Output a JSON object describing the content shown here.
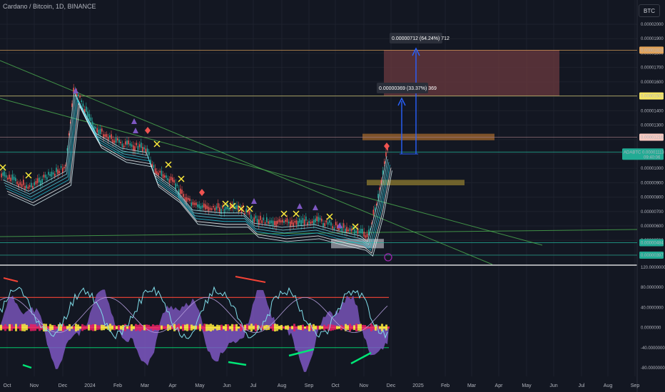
{
  "title": "Cardano / Bitcoin, 1D, BINANCE",
  "currency": "BTC",
  "chart_data": [
    {
      "type": "line",
      "name": "price",
      "x": [
        "Oct",
        "Nov",
        "Dec",
        "2024",
        "Feb",
        "Mar",
        "Apr",
        "May",
        "Jun",
        "Jul",
        "Aug",
        "Sep",
        "Oct",
        "Nov",
        "Dec",
        "2025",
        "Feb",
        "Mar",
        "Apr",
        "May",
        "Jun",
        "Jul",
        "Aug",
        "Sep"
      ],
      "price_path": [
        [
          "Oct",
          9.5e-06
        ],
        [
          "Nov",
          8.7e-06
        ],
        [
          "Nov",
          1.01e-05
        ],
        [
          "Dec",
          1.56e-05
        ],
        [
          "Dec",
          1.42e-05
        ],
        [
          "2024",
          1.27e-05
        ],
        [
          "Feb",
          1.17e-05
        ],
        [
          "Mar",
          1.14e-05
        ],
        [
          "Mar",
          1e-05
        ],
        [
          "Apr",
          8.9e-06
        ],
        [
          "May",
          7.4e-06
        ],
        [
          "Jun",
          7.2e-06
        ],
        [
          "Jul",
          7.2e-06
        ],
        [
          "Jul",
          6.5e-06
        ],
        [
          "Aug",
          6.2e-06
        ],
        [
          "Sep",
          6.4e-06
        ],
        [
          "Oct",
          6e-06
        ],
        [
          "Oct",
          5.6e-06
        ],
        [
          "Nov",
          5.2e-06
        ],
        [
          "Nov",
          8e-06
        ],
        [
          "Dec",
          1.113e-05
        ]
      ],
      "yaxis_ticks": [
        "0.00002000",
        "0.00001900",
        "0.00001800",
        "0.00001700",
        "0.00001600",
        "0.00001500",
        "0.00001400",
        "0.00001300",
        "0.00001200",
        "0.00001100",
        "0.00001000",
        "0.00000900",
        "0.00000800",
        "0.00000700",
        "0.00000600",
        "0.00000500",
        "0.00000400"
      ],
      "ylim": [
        3.7e-06,
        2.06e-05
      ],
      "price_labels": [
        {
          "value": 1.82e-05,
          "text": "0.00001820",
          "color": "#e2a35a"
        },
        {
          "value": 1.502e-05,
          "text": "0.00001502",
          "color": "#f5e663"
        },
        {
          "value": 1.216e-05,
          "text": "0.00001216",
          "color": "#f8c9c0"
        },
        {
          "value": 1.113e-05,
          "text": "ADABTC  0.00001113",
          "sub": "09:40:06",
          "color": "#22ab94"
        },
        {
          "value": 4.84e-06,
          "text": "0.00000484",
          "color": "#22ab94"
        },
        {
          "value": 3.97e-06,
          "text": "0.00000397",
          "color": "#22ab94"
        }
      ],
      "annotations": [
        {
          "text": "0.00000712 (64.24%) 712",
          "value": 1.82e-05
        },
        {
          "text": "0.00000369 (33.37%) 369",
          "value": 1.502e-05
        }
      ]
    },
    {
      "type": "area",
      "name": "oscillator",
      "yaxis_ticks": [
        "120.0000000",
        "80.0000000",
        "40.0000000",
        "0.0000000",
        "-40.0000000",
        "-80.0000000"
      ],
      "ylim": [
        -90,
        120
      ],
      "levels": [
        60,
        0,
        -40
      ]
    }
  ],
  "colors": {
    "background": "#131722",
    "grid": "#1e222d",
    "bull_candle": "#26a69a",
    "bear_candle": "#ef5350",
    "target_zone": "#6b3a3f",
    "supply_zone": "#8b5a2b",
    "demand_zone": "#7a6a2e",
    "base_zone": "#9598a1",
    "measure_arrow": "#2962ff",
    "trendline": "#4caf50",
    "osc_purple": "#7e57c2",
    "osc_pink": "#e91e63",
    "osc_yellow": "#ffeb3b",
    "osc_cyan": "#80deea",
    "osc_red": "#f44336",
    "osc_green": "#00e676"
  }
}
